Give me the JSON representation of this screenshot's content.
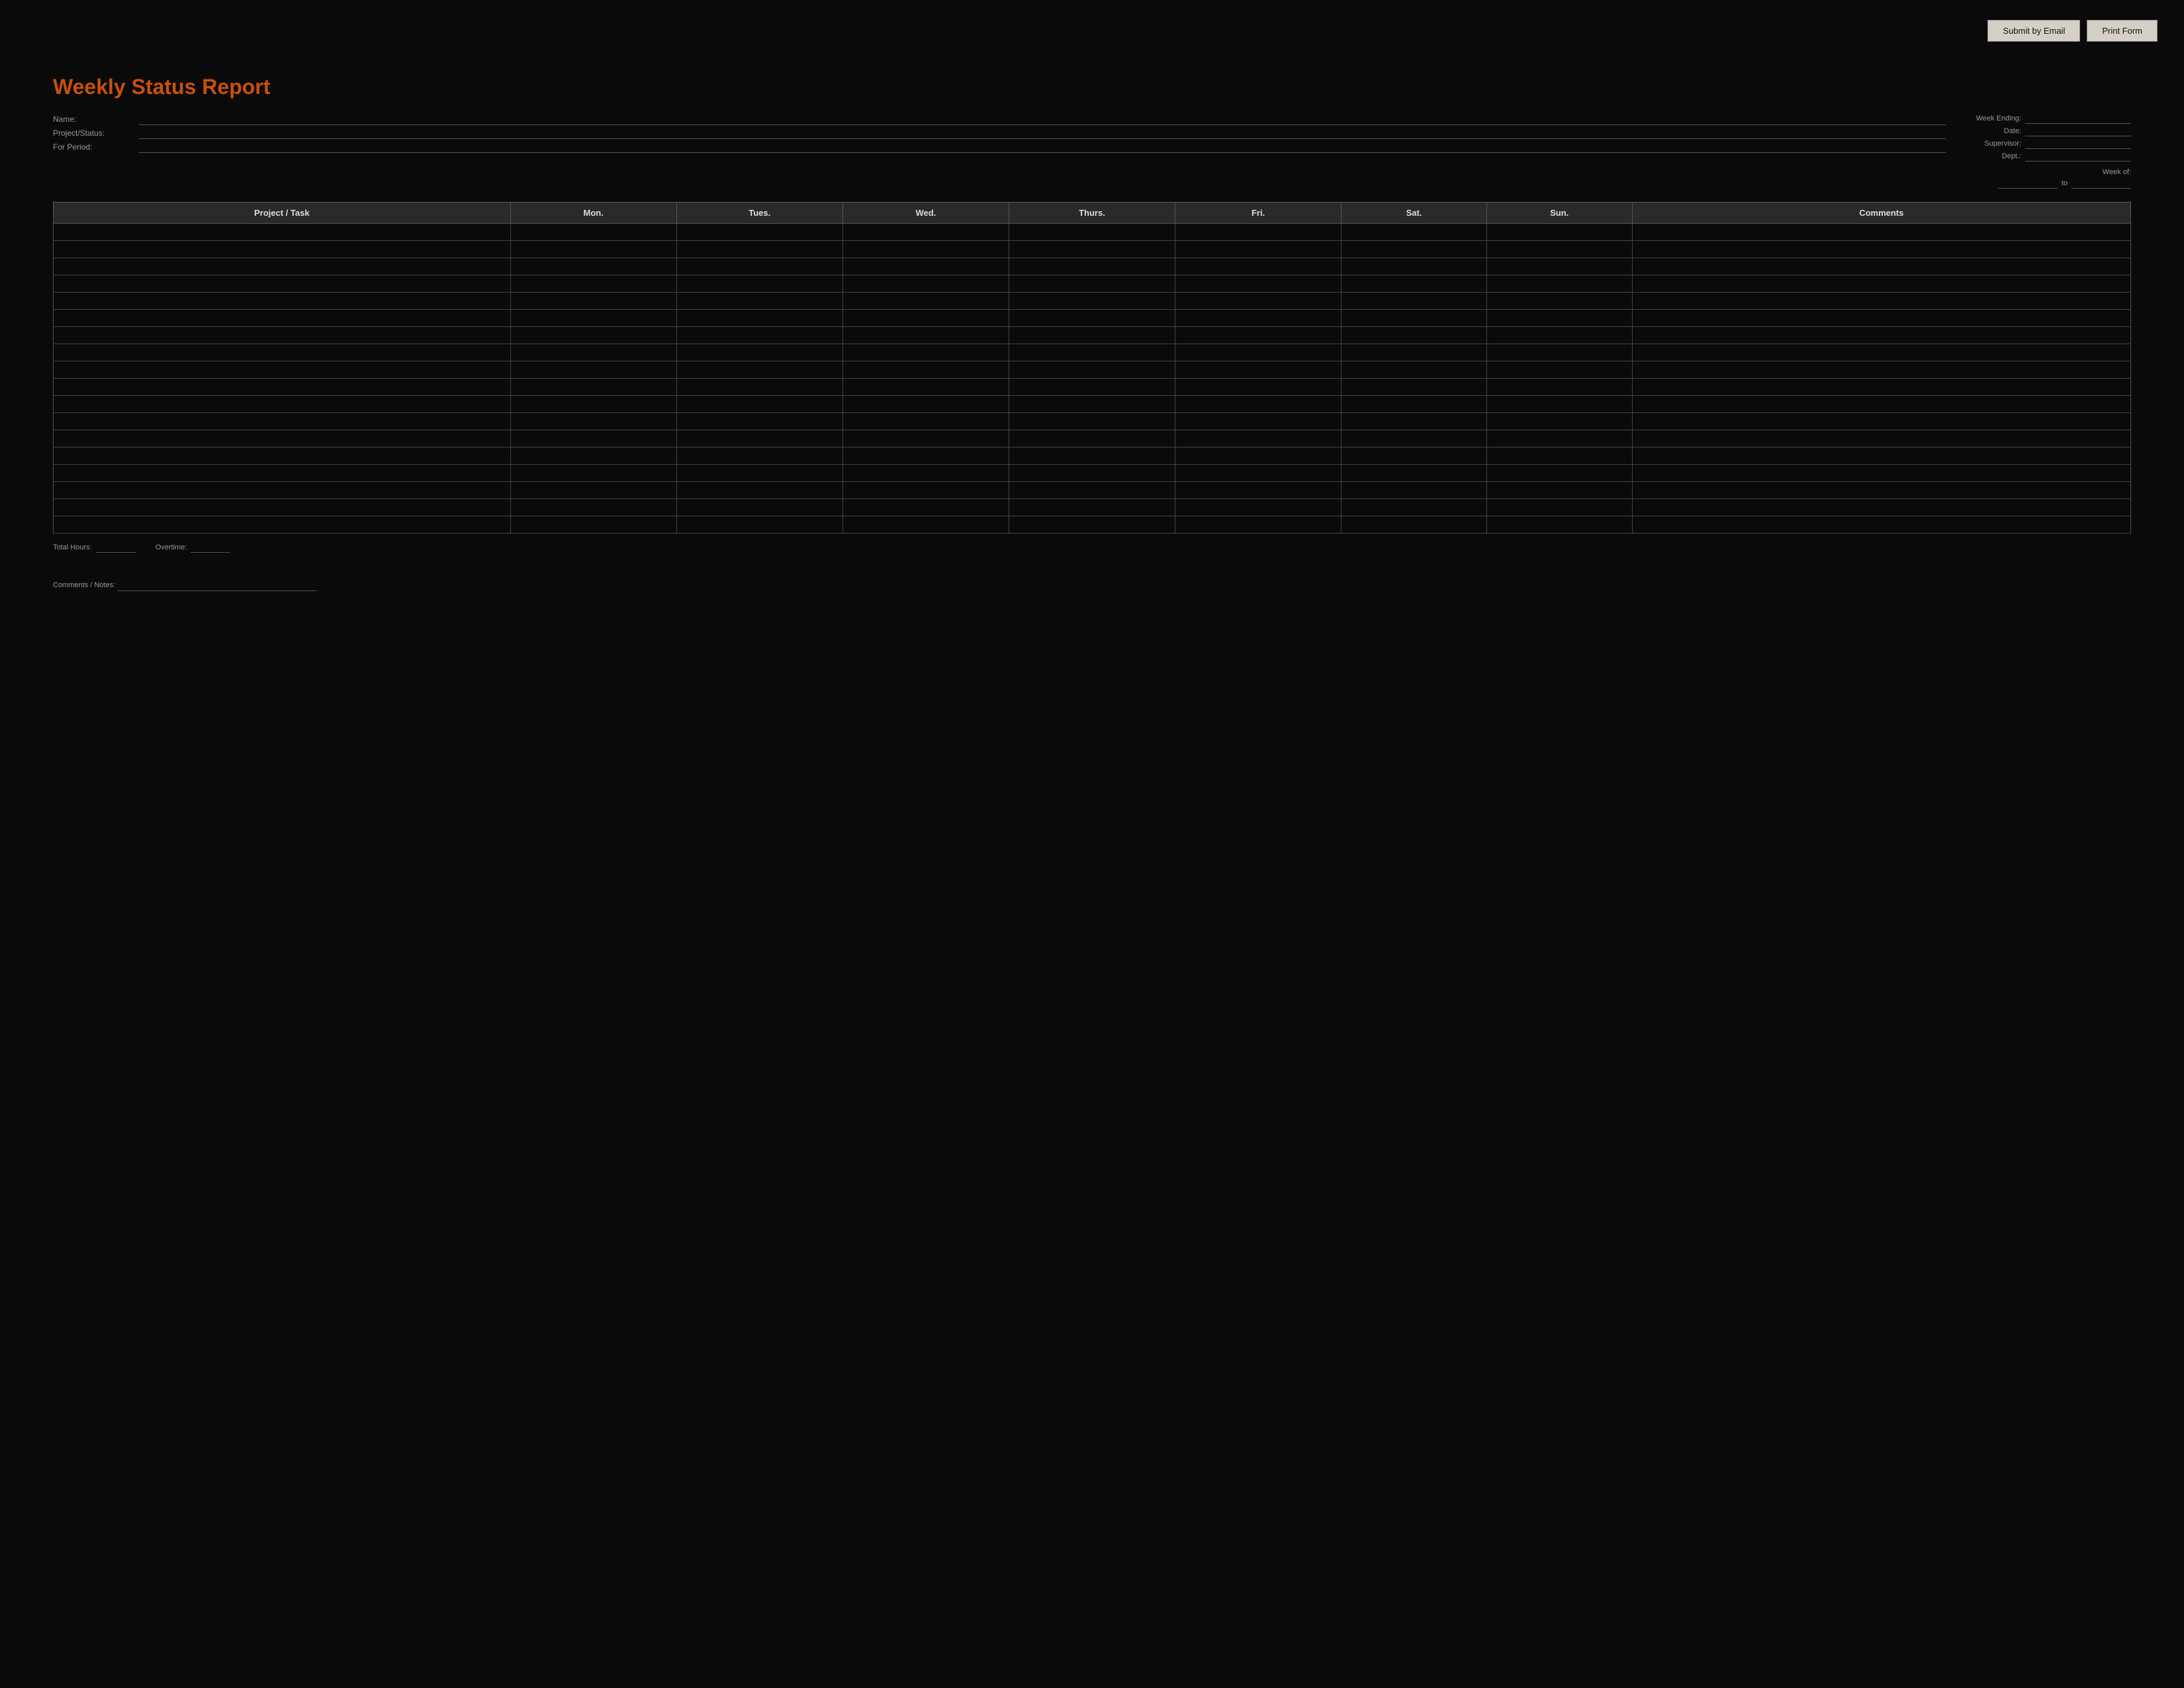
{
  "topbar": {
    "submit_email_label": "Submit by Email",
    "print_form_label": "Print Form"
  },
  "form": {
    "title": "Weekly Status Report",
    "fields": {
      "name_label": "Name:",
      "project_status_label": "Project/Status:",
      "for_period_label": "For Period:",
      "week_ending_label": "Week Ending:",
      "date_label": "Date:",
      "supervisor_label": "Supervisor:",
      "dept_label": "Dept.:",
      "week_of_label": "Week of:",
      "to_label": "to"
    },
    "table": {
      "columns": [
        "Project / Task",
        "Mon.",
        "Tues.",
        "Wed.",
        "Thurs.",
        "Fri.",
        "Sat.",
        "Sun.",
        "Comments"
      ],
      "col_widths": [
        "22%",
        "8%",
        "8%",
        "8%",
        "8%",
        "8%",
        "7%",
        "7%",
        "24%"
      ],
      "row_count": 18
    },
    "totals": {
      "total_hours_label": "Total Hours:",
      "overtime_label": "Overtime:"
    },
    "comments_section": {
      "label": "Comments / Notes:"
    }
  }
}
